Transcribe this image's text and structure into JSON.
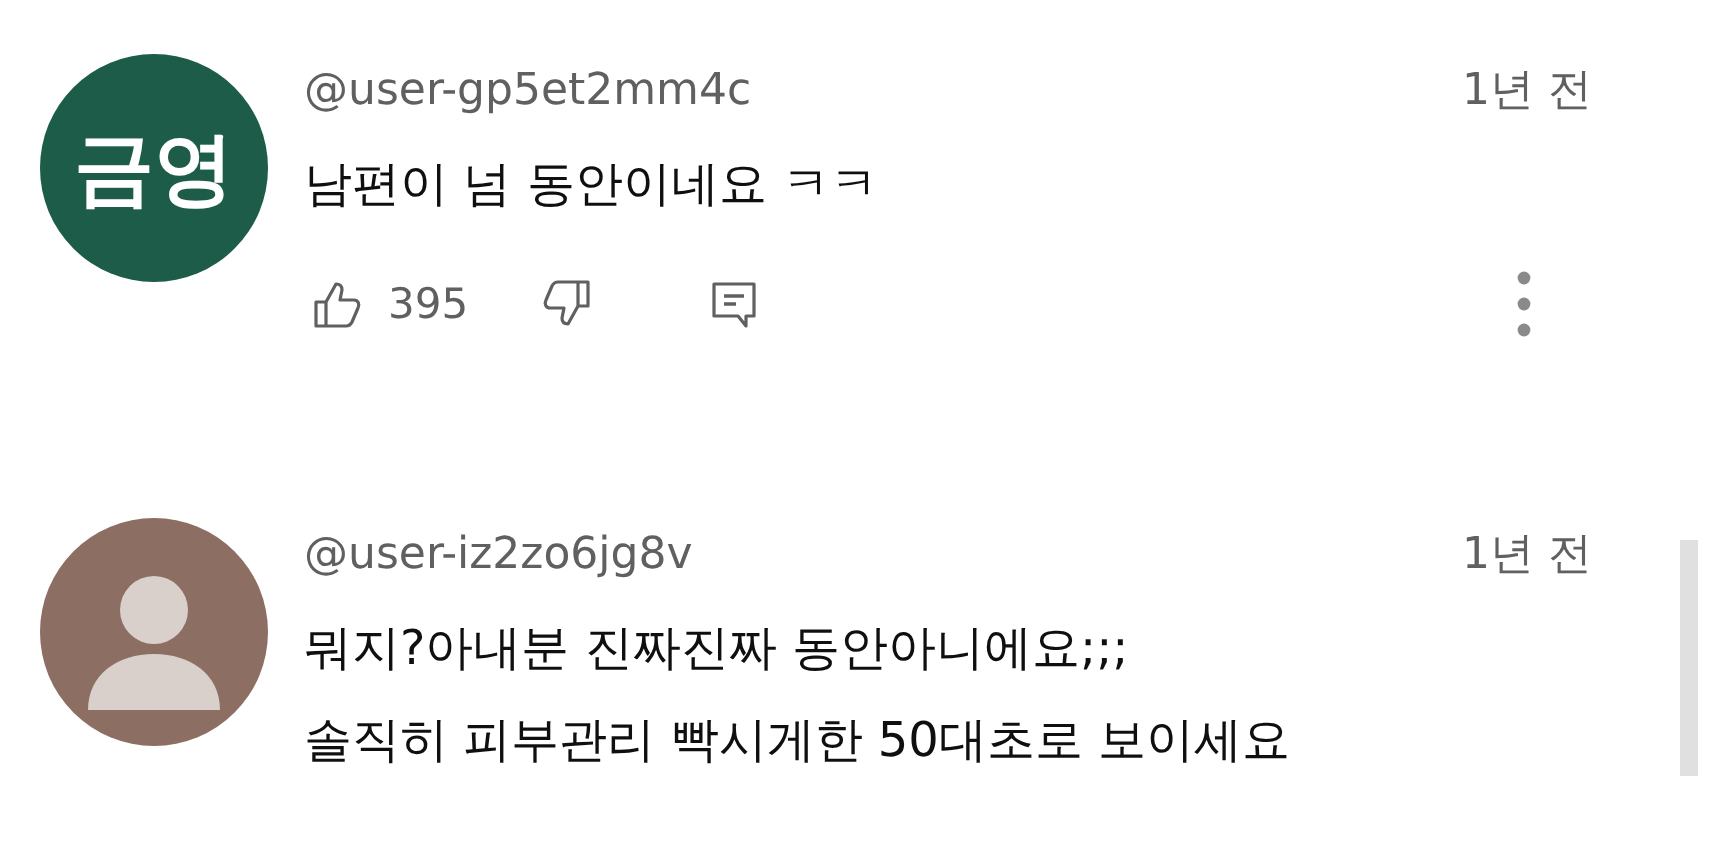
{
  "comments": [
    {
      "avatar": {
        "kind": "initials",
        "text": "금영",
        "color": "#1d5c48"
      },
      "handle": "@user-gp5et2mm4c",
      "time": "1년 전",
      "lines": [
        "남편이 넘 동안이네요 ㅋㅋ"
      ],
      "actions": {
        "likes": "395"
      }
    },
    {
      "avatar": {
        "kind": "silhouette",
        "color": "#8d6e63"
      },
      "handle": "@user-iz2zo6jg8v",
      "time": "1년 전",
      "lines": [
        "뭐지?아내분 진짜진짜 동안아니에요;;;",
        "솔직히 피부관리 빡시게한 50대초로 보이세요"
      ]
    }
  ]
}
